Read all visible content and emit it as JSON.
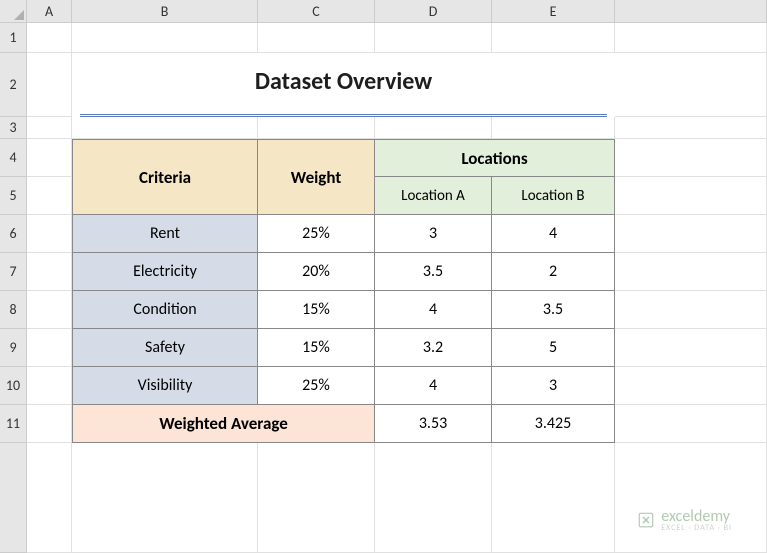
{
  "columns": [
    "A",
    "B",
    "C",
    "D",
    "E"
  ],
  "rows": [
    "1",
    "2",
    "3",
    "4",
    "5",
    "6",
    "7",
    "8",
    "9",
    "10",
    "11"
  ],
  "title": "Dataset Overview",
  "headers": {
    "criteria": "Criteria",
    "weight": "Weight",
    "locations": "Locations",
    "loc_a": "Location A",
    "loc_b": "Location B"
  },
  "data": [
    {
      "criteria": "Rent",
      "weight": "25%",
      "loc_a": "3",
      "loc_b": "4"
    },
    {
      "criteria": "Electricity",
      "weight": "20%",
      "loc_a": "3.5",
      "loc_b": "2"
    },
    {
      "criteria": "Condition",
      "weight": "15%",
      "loc_a": "4",
      "loc_b": "3.5"
    },
    {
      "criteria": "Safety",
      "weight": "15%",
      "loc_a": "3.2",
      "loc_b": "5"
    },
    {
      "criteria": "Visibility",
      "weight": "25%",
      "loc_a": "4",
      "loc_b": "3"
    }
  ],
  "footer": {
    "label": "Weighted Average",
    "loc_a": "3.53",
    "loc_b": "3.425"
  },
  "watermark": {
    "name": "exceldemy",
    "sub": "EXCEL · DATA · BI"
  },
  "chart_data": {
    "type": "table",
    "title": "Dataset Overview",
    "columns": [
      "Criteria",
      "Weight",
      "Location A",
      "Location B"
    ],
    "rows": [
      [
        "Rent",
        "25%",
        3,
        4
      ],
      [
        "Electricity",
        "20%",
        3.5,
        2
      ],
      [
        "Condition",
        "15%",
        4,
        3.5
      ],
      [
        "Safety",
        "15%",
        3.2,
        5
      ],
      [
        "Visibility",
        "25%",
        4,
        3
      ]
    ],
    "footer": [
      "Weighted Average",
      "",
      3.53,
      3.425
    ]
  }
}
